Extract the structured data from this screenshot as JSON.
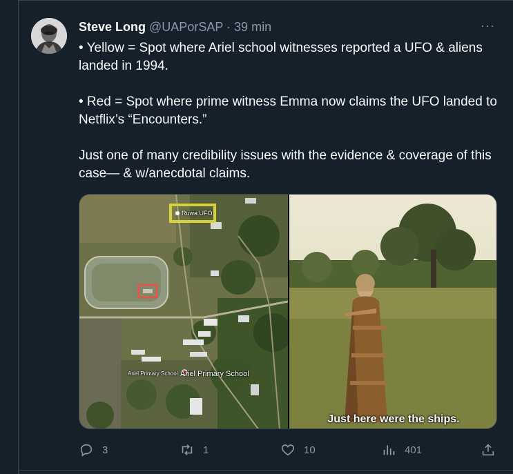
{
  "tweet": {
    "author_name": "Steve Long",
    "handle": "@UAPorSAP",
    "separator": "·",
    "time": "39 min",
    "more": "···",
    "lines": [
      "• Yellow = Spot where Ariel school witnesses reported a UFO & aliens landed in 1994.",
      "• Red = Spot where prime witness Emma now claims the UFO landed to Netflix’s “Encounters.”",
      "Just one of many credibility issues with the evidence & coverage of this case— & w/anecdotal claims."
    ]
  },
  "media": {
    "map": {
      "yellow_marker_label": "Ruwa UFO",
      "school_label": "Ariel Primary School",
      "school_label_small": "Ariel Primary School"
    },
    "video_caption": "Just here were the ships."
  },
  "actions": {
    "replies": "3",
    "retweets": "1",
    "likes": "10",
    "views": "401"
  },
  "colors": {
    "background": "#15202b",
    "text": "#f7f9f9",
    "muted": "#8b98a5",
    "yellow_marker": "#d7d23a",
    "red_marker": "#e0584b"
  }
}
